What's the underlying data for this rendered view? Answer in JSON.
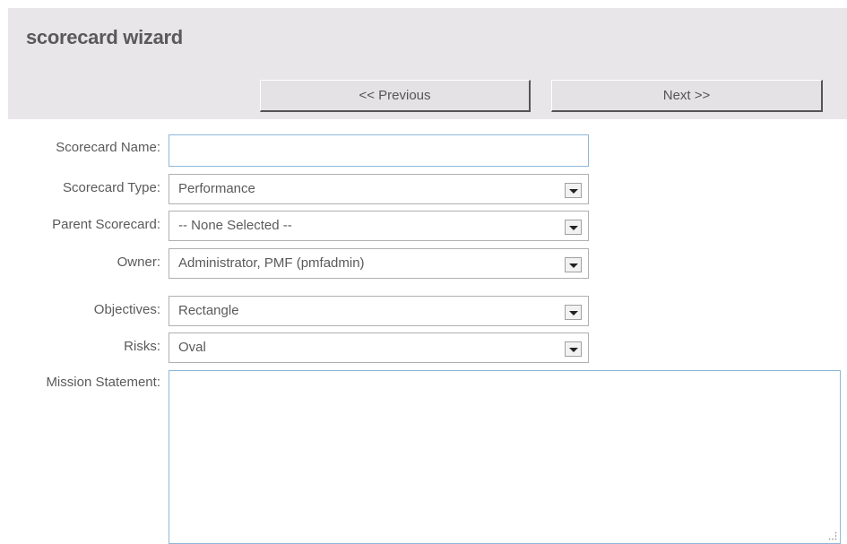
{
  "wizard": {
    "title": "scorecard wizard",
    "previous_label": "<< Previous",
    "next_label": "Next >>"
  },
  "form": {
    "scorecard_name": {
      "label": "Scorecard Name:",
      "value": ""
    },
    "scorecard_type": {
      "label": "Scorecard Type:",
      "value": "Performance"
    },
    "parent_scorecard": {
      "label": "Parent Scorecard:",
      "value": "-- None Selected --"
    },
    "owner": {
      "label": "Owner:",
      "value": "Administrator, PMF (pmfadmin)"
    },
    "objectives": {
      "label": "Objectives:",
      "value": "Rectangle"
    },
    "risks": {
      "label": "Risks:",
      "value": "Oval"
    },
    "mission_statement": {
      "label": "Mission Statement:",
      "value": ""
    }
  },
  "icons": {
    "dropdown": "chevron-down-icon",
    "resize": "resize-grip-icon"
  },
  "colors": {
    "header_bg": "#e8e6e9",
    "focus_border": "#8fb7d9",
    "text": "#5a5a5a"
  }
}
